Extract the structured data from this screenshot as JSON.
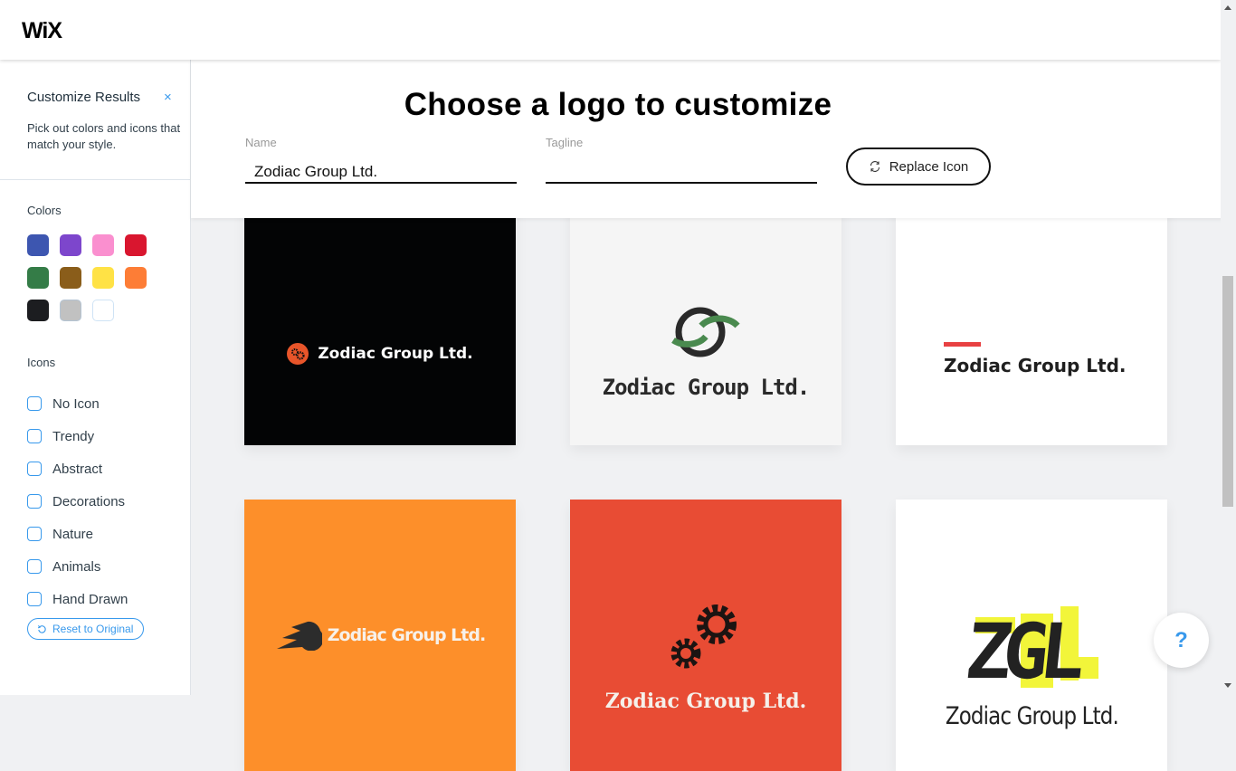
{
  "app": {
    "logo": "WiX"
  },
  "sidebar": {
    "title": "Customize Results",
    "close_symbol": "×",
    "description": "Pick out colors and icons that match your style.",
    "colors_label": "Colors",
    "colors": [
      {
        "name": "blue",
        "hex": "#3d56b0"
      },
      {
        "name": "purple",
        "hex": "#7d46cc"
      },
      {
        "name": "pink",
        "hex": "#fa8fcf"
      },
      {
        "name": "red",
        "hex": "#d9162f"
      },
      {
        "name": "green",
        "hex": "#347c47"
      },
      {
        "name": "brown",
        "hex": "#8a5d1a"
      },
      {
        "name": "yellow",
        "hex": "#ffe245"
      },
      {
        "name": "orange",
        "hex": "#fd7d36"
      },
      {
        "name": "black",
        "hex": "#1c1d20"
      },
      {
        "name": "gray",
        "hex": "#c1c1c1"
      },
      {
        "name": "white",
        "hex": "#ffffff"
      }
    ],
    "icons_label": "Icons",
    "icon_filters": [
      {
        "label": "No Icon",
        "checked": false
      },
      {
        "label": "Trendy",
        "checked": false
      },
      {
        "label": "Abstract",
        "checked": false
      },
      {
        "label": "Decorations",
        "checked": false
      },
      {
        "label": "Nature",
        "checked": false
      },
      {
        "label": "Animals",
        "checked": false
      },
      {
        "label": "Hand Drawn",
        "checked": false
      }
    ],
    "reset_label": "Reset to Original"
  },
  "header": {
    "title": "Choose a logo to customize",
    "name_label": "Name",
    "name_value": "Zodiac Group Ltd.",
    "tagline_label": "Tagline",
    "tagline_value": "",
    "replace_icon_label": "Replace Icon"
  },
  "logos": [
    {
      "text": "Zodiac Group Ltd.",
      "bg": "#030405",
      "fg": "#ffffff",
      "icon": "gears-circle-icon",
      "accent": "#e8552a"
    },
    {
      "text": "Zodiac Group Ltd.",
      "bg": "#f5f5f5",
      "fg": "#2a2a2a",
      "icon": "interlocking-rings-icon",
      "accent": "#4a8a4f"
    },
    {
      "text": "Zodiac Group Ltd.",
      "bg": "#ffffff",
      "fg": "#1f1f1f",
      "icon": "red-bar-icon",
      "accent": "#e84142"
    },
    {
      "text": "Zodiac Group Ltd.",
      "bg": "#fd8f2a",
      "fg": "#f7f1ea",
      "icon": "comet-icon",
      "accent": "#2c2c2c"
    },
    {
      "text": "Zodiac Group Ltd.",
      "bg": "#e84c34",
      "fg": "#f5f0ea",
      "icon": "gears-icon",
      "accent": "#1c1412"
    },
    {
      "text": "Zodiac Group Ltd.",
      "monogram": "ZGL",
      "bg": "#ffffff",
      "fg": "#222222",
      "icon": "monogram-icon",
      "accent": "#f2f53a"
    }
  ],
  "help": {
    "label": "?"
  }
}
